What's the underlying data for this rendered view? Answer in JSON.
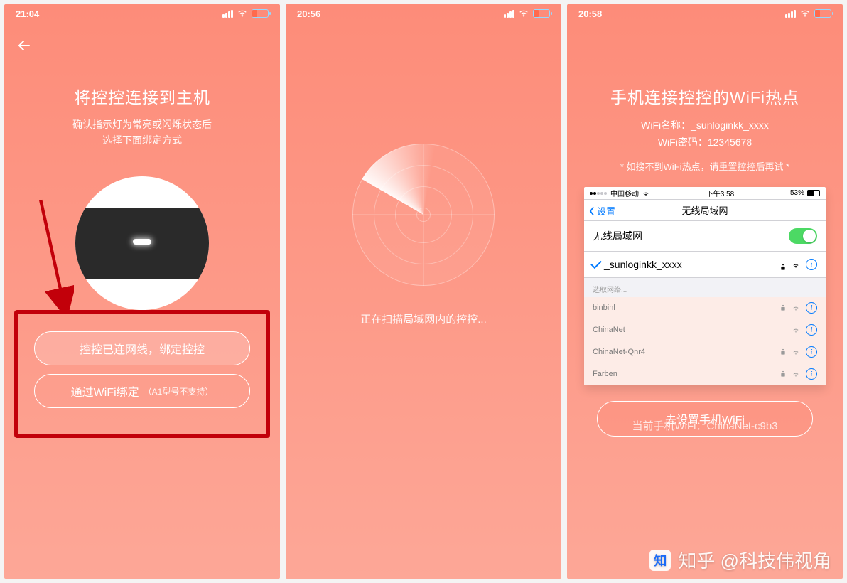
{
  "pane1": {
    "time": "21:04",
    "title": "将控控连接到主机",
    "subtitle_l1": "确认指示灯为常亮或闪烁状态后",
    "subtitle_l2": "选择下面绑定方式",
    "btn1": "控控已连网线，绑定控控",
    "btn2_main": "通过WiFi绑定",
    "btn2_note": "（A1型号不支持）"
  },
  "pane2": {
    "time": "20:56",
    "scanning": "正在扫描局域网内的控控..."
  },
  "pane3": {
    "time": "20:58",
    "title": "手机连接控控的WiFi热点",
    "wifi_name_label": "WiFi名称：",
    "wifi_name_value": "_sunloginkk_xxxx",
    "wifi_pwd_label": "WiFi密码：",
    "wifi_pwd_value": "12345678",
    "note": "* 如搜不到WiFi热点，请重置控控后再试 *",
    "ios": {
      "carrier": "中国移动",
      "clock": "下午3:58",
      "battery": "53%",
      "back": "设置",
      "nav_title": "无线局域网",
      "row_toggle": "无线局域网",
      "row_selected": "_sunloginkk_xxxx",
      "section_label": "选取网络...",
      "networks": [
        {
          "name": "binbinl",
          "lock": true,
          "wifi": true
        },
        {
          "name": "ChinaNet",
          "lock": false,
          "wifi": true
        },
        {
          "name": "ChinaNet-Qnr4",
          "lock": true,
          "wifi": true
        },
        {
          "name": "Farben",
          "lock": true,
          "wifi": true
        }
      ]
    },
    "current_label": "当前手机WiFi：",
    "current_value": "ChinaNet-c9b3",
    "goto_btn": "去设置手机WiFi"
  },
  "watermark": {
    "logo": "知",
    "text": "知乎 @科技伟视角"
  }
}
